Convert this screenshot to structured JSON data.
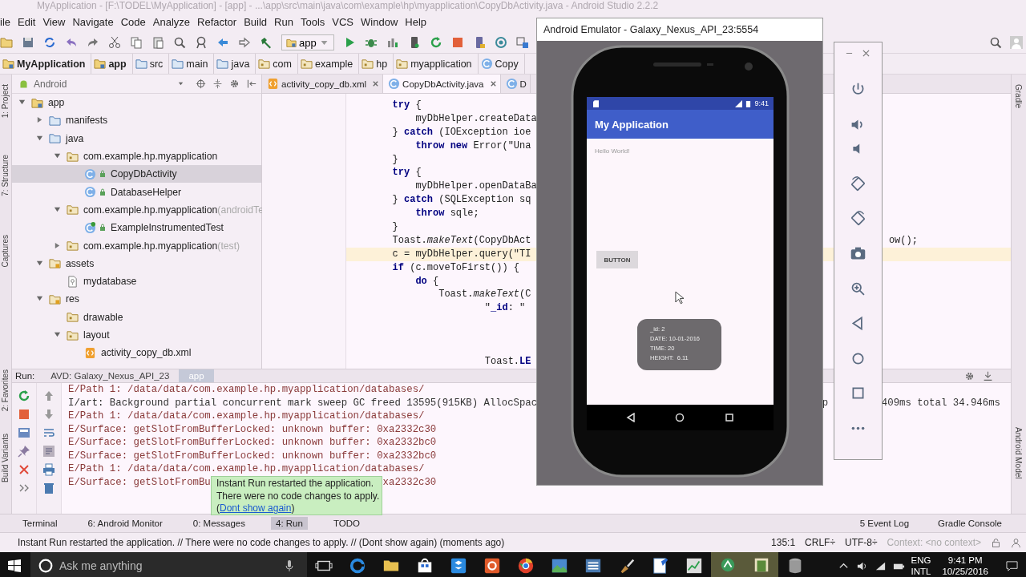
{
  "window": {
    "title": "MyApplication - [F:\\TODEL\\MyApplication] - [app] - ...\\app\\src\\main\\java\\com\\example\\hp\\myapplication\\CopyDbActivity.java - Android Studio 2.2.2"
  },
  "menu": [
    "ile",
    "Edit",
    "View",
    "Navigate",
    "Code",
    "Analyze",
    "Refactor",
    "Build",
    "Run",
    "Tools",
    "VCS",
    "Window",
    "Help"
  ],
  "toolbar": {
    "config": "app"
  },
  "breadcrumbs": [
    {
      "label": "MyApplication",
      "kind": "project"
    },
    {
      "label": "app",
      "kind": "module"
    },
    {
      "label": "src",
      "kind": "folder"
    },
    {
      "label": "main",
      "kind": "folder"
    },
    {
      "label": "java",
      "kind": "source"
    },
    {
      "label": "com",
      "kind": "package"
    },
    {
      "label": "example",
      "kind": "package"
    },
    {
      "label": "hp",
      "kind": "package"
    },
    {
      "label": "myapplication",
      "kind": "package"
    },
    {
      "label": "Copy",
      "kind": "class"
    }
  ],
  "left_strip": [
    "1: Project",
    "7: Structure",
    "Captures",
    "2: Favorites",
    "Build Variants"
  ],
  "right_strip": [
    "Gradle",
    "Android Model"
  ],
  "project_panel": {
    "view": "Android",
    "tree": [
      {
        "label": "app",
        "kind": "module",
        "expanded": true,
        "selected": false,
        "children": [
          {
            "label": "manifests",
            "kind": "folder",
            "expanded": false,
            "selected": false
          },
          {
            "label": "java",
            "kind": "folder",
            "expanded": true,
            "selected": false,
            "children": [
              {
                "label": "com.example.hp.myapplication",
                "kind": "package",
                "expanded": true,
                "selected": false,
                "children": [
                  {
                    "label": "CopyDbActivity",
                    "kind": "class",
                    "selected": true
                  },
                  {
                    "label": "DatabaseHelper",
                    "kind": "class",
                    "selected": false
                  }
                ]
              },
              {
                "label": "com.example.hp.myapplication",
                "note": "(androidTe",
                "kind": "package",
                "expanded": true,
                "selected": false,
                "children": [
                  {
                    "label": "ExampleInstrumentedTest",
                    "kind": "test-class",
                    "selected": false
                  }
                ]
              },
              {
                "label": "com.example.hp.myapplication",
                "note": "(test)",
                "kind": "package",
                "expanded": false,
                "selected": false
              }
            ]
          },
          {
            "label": "assets",
            "kind": "res-folder",
            "expanded": true,
            "selected": false,
            "children": [
              {
                "label": "mydatabase",
                "kind": "file",
                "selected": false
              }
            ]
          },
          {
            "label": "res",
            "kind": "res-folder",
            "expanded": true,
            "selected": false,
            "children": [
              {
                "label": "drawable",
                "kind": "package",
                "selected": false
              },
              {
                "label": "layout",
                "kind": "package",
                "expanded": true,
                "selected": false,
                "children": [
                  {
                    "label": "activity_copy_db.xml",
                    "kind": "xml",
                    "selected": false
                  }
                ]
              }
            ]
          }
        ]
      }
    ]
  },
  "editor": {
    "tabs": [
      {
        "label": "activity_copy_db.xml",
        "kind": "xml",
        "selected": false
      },
      {
        "label": "CopyDbActivity.java",
        "kind": "class",
        "selected": true
      },
      {
        "label": "D",
        "kind": "class",
        "selected": false
      }
    ],
    "lines": [
      {
        "text": "        **try** {",
        "current": false
      },
      {
        "text": "            myDbHelper.createData",
        "current": false
      },
      {
        "text": "        } **catch** (IOException ioe",
        "current": false
      },
      {
        "text": "            **throw** **new** Error(\"Una",
        "current": false
      },
      {
        "text": "        }",
        "current": false
      },
      {
        "text": "        **try** {",
        "current": false
      },
      {
        "text": "            myDbHelper.openDataBa",
        "current": false
      },
      {
        "text": "        } **catch** (SQLException sq",
        "current": false
      },
      {
        "text": "            **throw** sqle;",
        "current": false
      },
      {
        "text": "        }",
        "current": false
      },
      {
        "text": "        Toast.*makeText*(CopyDbAct",
        "current": false,
        "tail": "ow();"
      },
      {
        "text": "        c = myDbHelper.query(\"TI",
        "current": true
      },
      {
        "text": "        **if** (c.moveToFirst()) {",
        "current": false
      },
      {
        "text": "            **do** {",
        "current": false
      },
      {
        "text": "                Toast.*makeText*(C",
        "current": false
      },
      {
        "text": "                        \"**_id**: \"",
        "current": false
      },
      {
        "text": "                        Toast.**LE**",
        "current": false
      }
    ]
  },
  "run_panel": {
    "label": "Run:",
    "tabs": [
      {
        "label": "AVD: Galaxy_Nexus_API_23",
        "selected": false
      },
      {
        "label": "app",
        "selected": true
      }
    ],
    "log": [
      {
        "text": "E/Path 1: /data/data/com.example.hp.myapplication/databases/"
      },
      {
        "text": "I/art: Background partial concurrent mark sweep GC freed 13595(915KB) AllocSpac",
        "tails": [
          "p",
          "409ms total 34.946ms"
        ]
      },
      {
        "text": "E/Path 1: /data/data/com.example.hp.myapplication/databases/"
      },
      {
        "text": "E/Surface: getSlotFromBufferLocked: unknown buffer: 0xa2332c30"
      },
      {
        "text": "E/Surface: getSlotFromBufferLocked: unknown buffer: 0xa2332bc0"
      },
      {
        "text": "E/Surface: getSlotFromBufferLocked: unknown buffer: 0xa2332bc0"
      },
      {
        "text": "E/Path 1: /data/data/com.example.hp.myapplication/databases/"
      },
      {
        "text": "E/Surface: getSlotFromBu",
        "tails": [
          "xa2332c30"
        ]
      }
    ]
  },
  "balloon": {
    "lines": [
      "Instant Run restarted the application.",
      "There were no code changes to apply."
    ],
    "link_before": "(",
    "link": "Dont show again",
    "link_after": ")"
  },
  "tool_tabs": [
    {
      "label": "Terminal",
      "selected": false
    },
    {
      "label": "6: Android Monitor",
      "selected": false
    },
    {
      "label": "0: Messages",
      "selected": false
    },
    {
      "label": "4: Run",
      "selected": true
    },
    {
      "label": "TODO",
      "selected": false
    }
  ],
  "tool_tabs_right": [
    "5 Event Log",
    "Gradle Console"
  ],
  "status_bar": {
    "message": "Instant Run restarted the application. // There were no code changes to apply. // (Dont show again) (moments ago)",
    "position": "135:1",
    "line_separator": "CRLF÷",
    "encoding": "UTF-8÷",
    "context": "Context: <no context>"
  },
  "emulator": {
    "title": "Android Emulator - Galaxy_Nexus_API_23:5554",
    "time": "9:41",
    "app_title": "My Application",
    "hello": "Hello World!",
    "button": "BUTTON",
    "toast": [
      "_id: 2",
      "DATE: 10-01-2016",
      "TIME: 20",
      "HEIGHT:  6.11"
    ]
  },
  "taskbar": {
    "search_placeholder": "Ask me anything",
    "language": "ENG",
    "layout": "INTL",
    "time": "9:41 PM",
    "date": "10/25/2016"
  }
}
